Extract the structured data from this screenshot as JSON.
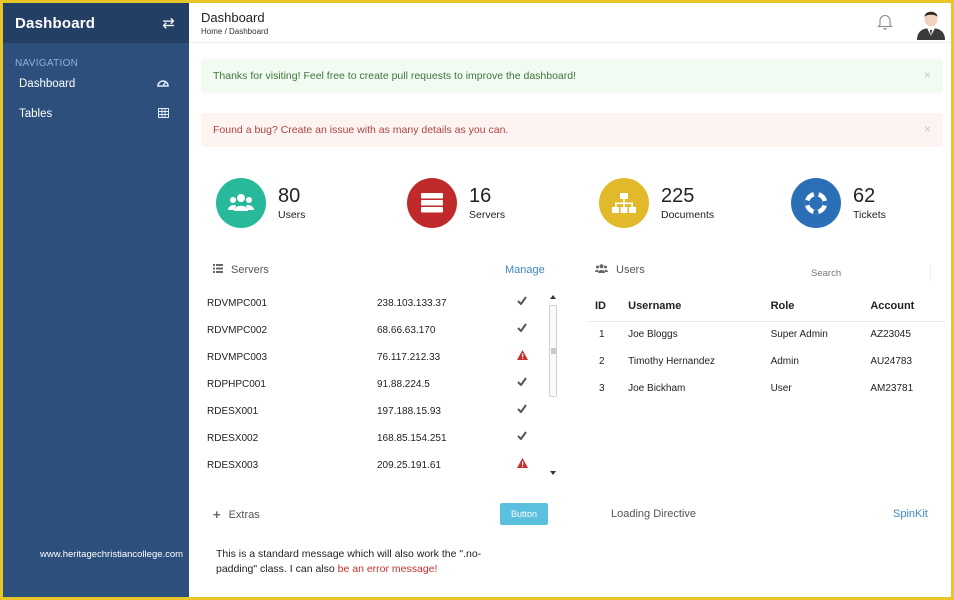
{
  "sidebar": {
    "title": "Dashboard",
    "toggle_icon": "swap-icon",
    "section": "NAVIGATION",
    "items": [
      {
        "label": "Dashboard",
        "icon": "gauge-icon"
      },
      {
        "label": "Tables",
        "icon": "table-icon"
      }
    ],
    "watermark": "www.heritagechristiancollege.com"
  },
  "header": {
    "title": "Dashboard",
    "breadcrumb": "Home / Dashboard"
  },
  "alerts": {
    "success": "Thanks for visiting! Feel free to create pull requests to improve the dashboard!",
    "danger": "Found a bug? Create an issue with as many details as you can.",
    "close": "×"
  },
  "stats": [
    {
      "value": "80",
      "label": "Users",
      "color": "#27b99a",
      "icon": "users-icon"
    },
    {
      "value": "16",
      "label": "Servers",
      "color": "#c12a2a",
      "icon": "server-icon"
    },
    {
      "value": "225",
      "label": "Documents",
      "color": "#e2b92b",
      "icon": "sitemap-icon"
    },
    {
      "value": "62",
      "label": "Tickets",
      "color": "#2b6fb6",
      "icon": "lifering-icon"
    }
  ],
  "servers": {
    "title": "Servers",
    "manage": "Manage",
    "rows": [
      {
        "name": "RDVMPC001",
        "ip": "238.103.133.37",
        "status": "ok"
      },
      {
        "name": "RDVMPC002",
        "ip": "68.66.63.170",
        "status": "ok"
      },
      {
        "name": "RDVMPC003",
        "ip": "76.117.212.33",
        "status": "warning"
      },
      {
        "name": "RDPHPC001",
        "ip": "91.88.224.5",
        "status": "ok"
      },
      {
        "name": "RDESX001",
        "ip": "197.188.15.93",
        "status": "ok"
      },
      {
        "name": "RDESX002",
        "ip": "168.85.154.251",
        "status": "ok"
      },
      {
        "name": "RDESX003",
        "ip": "209.25.191.61",
        "status": "warning"
      }
    ]
  },
  "users": {
    "title": "Users",
    "search_placeholder": "Search",
    "columns": [
      "ID",
      "Username",
      "Role",
      "Account"
    ],
    "rows": [
      [
        "1",
        "Joe Bloggs",
        "Super Admin",
        "AZ23045"
      ],
      [
        "2",
        "Timothy Hernandez",
        "Admin",
        "AU24783"
      ],
      [
        "3",
        "Joe Bickham",
        "User",
        "AM23781"
      ]
    ]
  },
  "extras": {
    "title": "Extras",
    "button": "Button",
    "message": "This is a standard message which will also work the \".no-padding\" class. I can also ",
    "error": "be an error message!"
  },
  "loading": {
    "title": "Loading Directive",
    "link": "SpinKit"
  },
  "colors": {
    "sidebar": "#2c4f7c",
    "sidebar_header": "#243f66",
    "link": "#3d88c2",
    "ok": "#555555",
    "warning": "#c9302c"
  }
}
